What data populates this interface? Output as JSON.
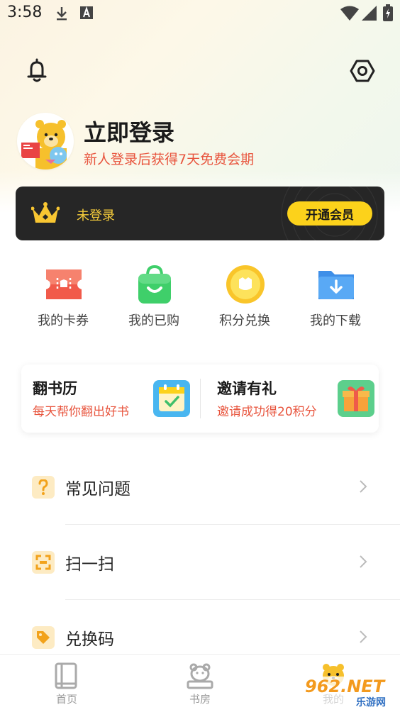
{
  "status_bar": {
    "time": "3:58"
  },
  "profile": {
    "title": "立即登录",
    "subtitle": "新人登录后获得7天免费会期"
  },
  "vip": {
    "status": "未登录",
    "button": "开通会员",
    "accent": "#fcd21b"
  },
  "quick_actions": [
    {
      "label": "我的卡券",
      "icon": "ticket-icon",
      "color": "#f15a4a"
    },
    {
      "label": "我的已购",
      "icon": "shopping-bag-icon",
      "color": "#3fcf6a"
    },
    {
      "label": "积分兑换",
      "icon": "coin-icon",
      "color": "#fccd2a"
    },
    {
      "label": "我的下载",
      "icon": "download-folder-icon",
      "color": "#4aa0f2"
    }
  ],
  "promos": [
    {
      "title": "翻书历",
      "subtitle": "每天帮你翻出好书",
      "icon": "calendar-icon"
    },
    {
      "title": "邀请有礼",
      "subtitle": "邀请成功得20积分",
      "icon": "gift-icon"
    }
  ],
  "menu": [
    {
      "label": "常见问题",
      "icon": "question-icon"
    },
    {
      "label": "扫一扫",
      "icon": "scan-icon"
    },
    {
      "label": "兑换码",
      "icon": "tag-icon"
    }
  ],
  "bottom_nav": [
    {
      "label": "首页",
      "icon": "book-icon"
    },
    {
      "label": "书房",
      "icon": "bookshelf-bear-icon"
    },
    {
      "label": "我的",
      "icon": "profile-bear-icon"
    }
  ],
  "watermark": {
    "text": "962.NET",
    "subtext": "乐游网"
  }
}
